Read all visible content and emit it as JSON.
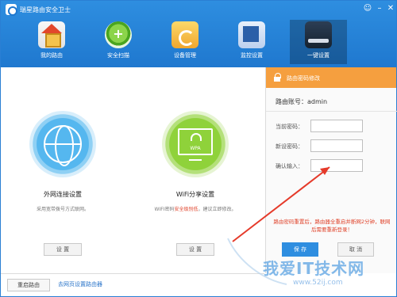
{
  "app": {
    "title": "瑞星路由安全卫士"
  },
  "nav": [
    {
      "label": "我的路由"
    },
    {
      "label": "安全扫描"
    },
    {
      "label": "设备管理"
    },
    {
      "label": "监控设置"
    },
    {
      "label": "一键设置"
    }
  ],
  "cards": {
    "wan": {
      "title": "外网连接设置",
      "desc": "采用宽带拨号方式联网。",
      "button": "设 置"
    },
    "wifi": {
      "title": "WiFi分享设置",
      "desc_pre": "WIFI密码",
      "desc_red": "安全级别低",
      "desc_post": "，建议立即修改。",
      "icon_text": "WPA",
      "button": "设 置"
    }
  },
  "footer": {
    "restart": "重启路由",
    "link": "去网页设置路由器"
  },
  "panel": {
    "title": "路由密码修改",
    "account_label": "路由账号：admin",
    "fields": [
      {
        "label": "当前密码：",
        "value": ""
      },
      {
        "label": "新设密码：",
        "value": ""
      },
      {
        "label": "确认输入：",
        "value": ""
      }
    ],
    "warning": "路由密码重置后，路由器全重启并断网2分钟，联网后需要重新登录！",
    "save": "保 存",
    "cancel": "取 消"
  },
  "watermark": {
    "main": "我爱IT技术网",
    "sub": "www.52ij.com"
  },
  "colors": {
    "header": "#1f78cf",
    "panel_head": "#f59f3f",
    "warning": "#e0442c",
    "save": "#2e8ee0",
    "arrow": "#e53a2a"
  }
}
